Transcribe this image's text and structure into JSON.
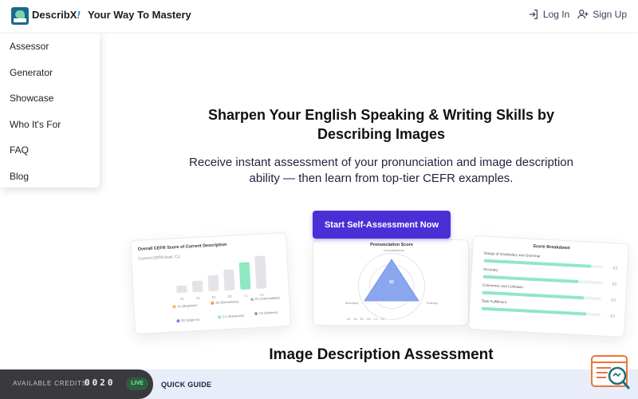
{
  "header": {
    "brand": "DescribX",
    "brand_accent": "!",
    "tagline": "Your Way To Mastery",
    "login_label": "Log In",
    "signup_label": "Sign Up"
  },
  "menu": {
    "items": [
      {
        "label": "Assessor"
      },
      {
        "label": "Generator"
      },
      {
        "label": "Showcase"
      },
      {
        "label": "Who It's For"
      },
      {
        "label": "FAQ"
      },
      {
        "label": "Blog"
      }
    ]
  },
  "hero": {
    "title_line1": "Sharpen Your English Speaking & Writing Skills by",
    "title_line2": "Describing Images",
    "subtitle_line1": "Receive instant assessment of your pronunciation and image description",
    "subtitle_line2": "ability — then learn from top-tier CEFR examples.",
    "cta_label": "Start Self-Assessment Now"
  },
  "preview": {
    "left": {
      "title": "Overall CEFR Score of Current Description",
      "subtitle": "Current CEFR level: C1",
      "bar_levels": [
        0.18,
        0.3,
        0.42,
        0.55,
        0.7,
        0.85
      ],
      "bar_ticks": [
        "A1",
        "A2",
        "B1",
        "B2",
        "C1",
        "C2"
      ],
      "highlighted_index": 4,
      "legend": [
        "A1 (Beginner)",
        "A2 (Elementary)",
        "B1 (Intermediate)",
        "B2 Upper Int.",
        "C1 (Advanced)",
        "C2 (Mastery)"
      ]
    },
    "middle": {
      "title": "Pronunciation Score",
      "value": "82",
      "labels": [
        "Accuracy",
        "Fluency",
        "Completeness"
      ],
      "legend": "A1 · A2 · B1 · B2 · C1 · C2"
    },
    "right": {
      "title": "Score Breakdown",
      "rows": [
        {
          "label": "Range of Vocabulary and Grammar",
          "level": 0.9,
          "value": "C1"
        },
        {
          "label": "Accuracy",
          "level": 0.8,
          "value": "C1"
        },
        {
          "label": "Coherence and Cohesion",
          "level": 0.85,
          "value": "C1"
        },
        {
          "label": "Task Fulfillment",
          "level": 0.88,
          "value": "C1"
        }
      ]
    }
  },
  "section": {
    "title": "Image Description Assessment"
  },
  "bottom": {
    "credits_label": "AVAILABLE CREDITS",
    "credits_value": "0020",
    "live_label": "LIVE",
    "quick_guide_label": "QUICK GUIDE"
  },
  "colors": {
    "primary": "#4b2fd6",
    "accent_green": "#8fe8c1",
    "help_orange": "#e8763a",
    "help_teal": "#1f6f7a"
  }
}
